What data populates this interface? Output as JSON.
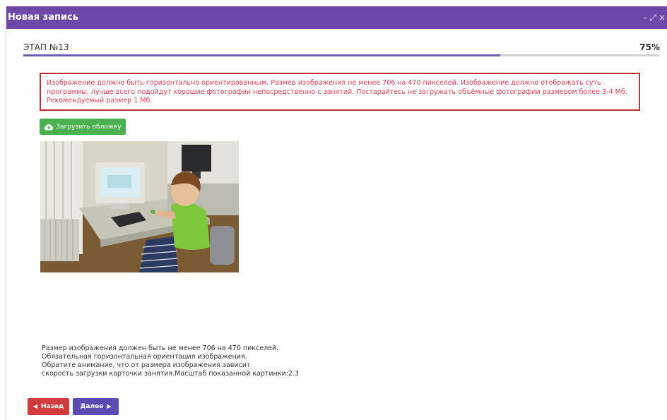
{
  "window": {
    "title": "Новая запись",
    "controls": {
      "minimize": "–",
      "maximize": "⤢",
      "close": "×"
    }
  },
  "stage": {
    "label": "ЭТАП №13",
    "percent_text": "75%",
    "progress": 0.75
  },
  "warning": {
    "text": "Изображение должно быть горизонтально ориентированным. Размер изображения не менее 706 на 470 пикселей. Изображение должно отображать суть программы, лучше всего подойдут хорошие фотографии непосредственно с занятий. Постарайтесь не загружать объёмные фотографии размером более 3-4 Мб. Рекомендуемый размер 1 Мб."
  },
  "upload": {
    "label": "Загрузить обложку",
    "icon": "cloud-upload-icon"
  },
  "info": {
    "line1": "Размер изображения должен быть не менее 706 на 470 пикселей.",
    "line2": "Обязательная горизонтальная ориентация изображения.",
    "line3": "Обратите внимание, что от размера изображения зависит",
    "line4": "скорость загрузки карточки занятия.Масштаб показанной картинки:2.3"
  },
  "nav": {
    "back_label": "Назад",
    "next_label": "Далее"
  },
  "colors": {
    "header": "#6c49a8",
    "progress": "#6c5ab4",
    "warning": "#c0303a",
    "upload": "#4caf50",
    "back": "#d23b3b",
    "next": "#5b4ab0"
  }
}
